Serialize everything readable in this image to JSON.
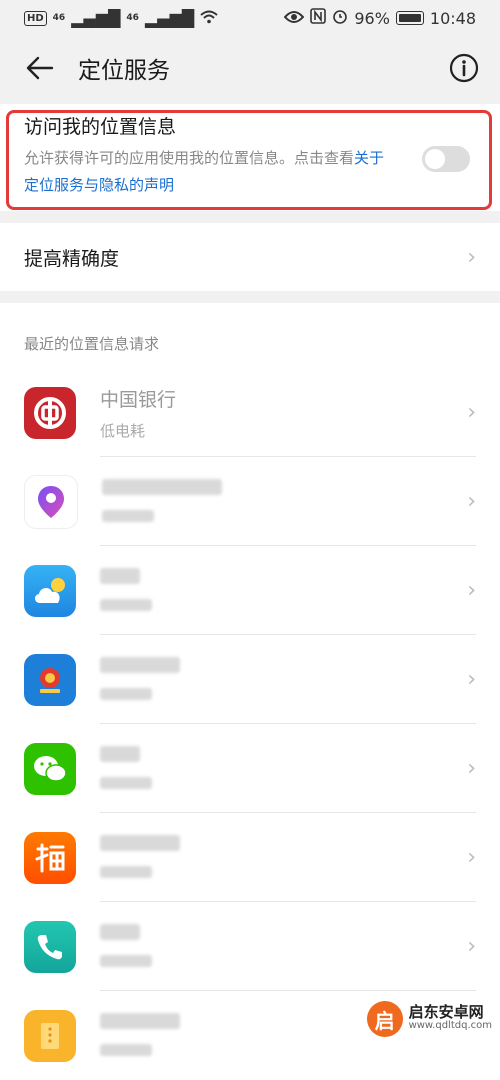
{
  "status_bar": {
    "left_badge": "HD",
    "sig1": "46",
    "sig2": "46",
    "battery_pct": "96%",
    "time": "10:48"
  },
  "header": {
    "title": "定位服务"
  },
  "location_access": {
    "title": "访问我的位置信息",
    "desc": "允许获得许可的应用使用我的位置信息。点击查看",
    "link": "关于定位服务与隐私的声明",
    "enabled": false
  },
  "accuracy": {
    "label": "提高精确度"
  },
  "recent": {
    "section_title": "最近的位置信息请求",
    "apps": [
      {
        "name": "中国银行",
        "sub": "低电耗",
        "icon": "boc-icon",
        "color": "#c8252c"
      },
      {
        "name": "",
        "sub": "",
        "icon": "map-pin-icon",
        "color": "#ffffff"
      },
      {
        "name": "",
        "sub": "",
        "icon": "weather-icon",
        "color": "#2aa0f0"
      },
      {
        "name": "",
        "sub": "",
        "icon": "tax-emblem-icon",
        "color": "#1e7fd8"
      },
      {
        "name": "",
        "sub": "",
        "icon": "wechat-icon",
        "color": "#2dc100"
      },
      {
        "name": "",
        "sub": "",
        "icon": "taobao-icon",
        "color": "#ff5000"
      },
      {
        "name": "",
        "sub": "",
        "icon": "phone-icon",
        "color": "#1dbba6"
      },
      {
        "name": "",
        "sub": "",
        "icon": "files-icon",
        "color": "#f9b42b"
      }
    ]
  },
  "watermark": {
    "title": "启东安卓网",
    "url": "www.qdltdq.com",
    "glyph": "启"
  }
}
